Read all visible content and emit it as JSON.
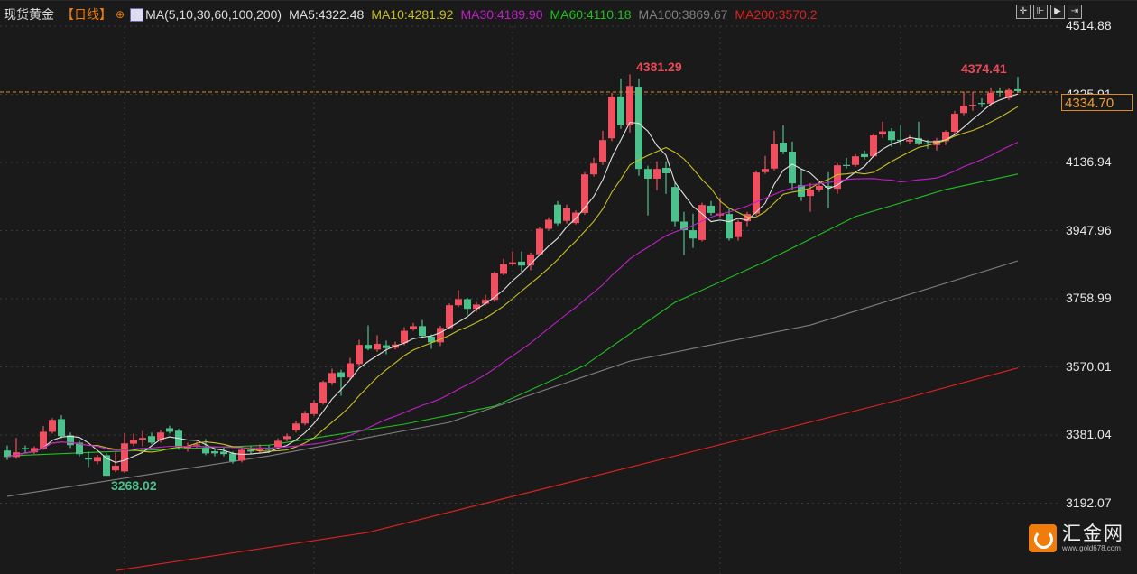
{
  "header": {
    "instrument": "现货黄金",
    "period": "【日线】",
    "ma_params": "MA(5,10,30,60,100,200)",
    "ma5": "MA5:4322.48",
    "ma10": "MA10:4281.92",
    "ma30": "MA30:4189.90",
    "ma60": "MA60:4110.18",
    "ma100": "MA100:3869.67",
    "ma200": "MA200:3570.2"
  },
  "toolbar": {
    "icons": [
      "crosshair-icon",
      "zoom-range-icon",
      "play-icon",
      "jump-end-icon"
    ]
  },
  "colors": {
    "up": "#f04f5f",
    "down": "#4dc18c",
    "ma5": "#e0e0e0",
    "ma10": "#c8c020",
    "ma30": "#c020c8",
    "ma60": "#20c020",
    "ma100": "#808080",
    "ma200": "#e02020",
    "current": "#e08a1e"
  },
  "chart_data": {
    "type": "candlestick",
    "y_axis_ticks": [
      "4514.88",
      "4325.91",
      "4136.94",
      "3947.96",
      "3758.99",
      "3570.01",
      "3381.04",
      "3192.07"
    ],
    "ylim": [
      3005,
      4560
    ],
    "grid": true,
    "current_price": "4334.70",
    "annotations": {
      "high1": "4381.29",
      "high2": "4374.41",
      "low1": "3268.02"
    },
    "ohlc": [
      [
        3338,
        3352,
        3312,
        3320
      ],
      [
        3320,
        3373,
        3315,
        3333
      ],
      [
        3345,
        3352,
        3330,
        3341
      ],
      [
        3333,
        3350,
        3328,
        3345
      ],
      [
        3343,
        3406,
        3340,
        3390
      ],
      [
        3390,
        3428,
        3385,
        3423
      ],
      [
        3425,
        3436,
        3372,
        3378
      ],
      [
        3380,
        3388,
        3345,
        3353
      ],
      [
        3360,
        3365,
        3322,
        3328
      ],
      [
        3318,
        3335,
        3292,
        3313
      ],
      [
        3308,
        3326,
        3300,
        3320
      ],
      [
        3325,
        3330,
        3268.02,
        3268
      ],
      [
        3283,
        3333,
        3278,
        3296
      ],
      [
        3280,
        3386,
        3276,
        3358
      ],
      [
        3357,
        3385,
        3350,
        3368
      ],
      [
        3368,
        3392,
        3350,
        3373
      ],
      [
        3378,
        3388,
        3355,
        3360
      ],
      [
        3366,
        3395,
        3360,
        3388
      ],
      [
        3400,
        3407,
        3385,
        3390
      ],
      [
        3393,
        3398,
        3340,
        3348
      ],
      [
        3345,
        3360,
        3335,
        3350
      ],
      [
        3352,
        3362,
        3345,
        3355
      ],
      [
        3345,
        3370,
        3325,
        3330
      ],
      [
        3336,
        3345,
        3322,
        3330
      ],
      [
        3335,
        3348,
        3322,
        3328
      ],
      [
        3330,
        3335,
        3302,
        3308
      ],
      [
        3310,
        3345,
        3305,
        3340
      ],
      [
        3340,
        3350,
        3328,
        3335
      ],
      [
        3338,
        3355,
        3332,
        3343
      ],
      [
        3345,
        3352,
        3334,
        3340
      ],
      [
        3348,
        3372,
        3344,
        3365
      ],
      [
        3370,
        3385,
        3364,
        3378
      ],
      [
        3394,
        3420,
        3388,
        3413
      ],
      [
        3413,
        3448,
        3408,
        3441
      ],
      [
        3439,
        3478,
        3434,
        3470
      ],
      [
        3470,
        3532,
        3465,
        3528
      ],
      [
        3526,
        3565,
        3520,
        3553
      ],
      [
        3555,
        3562,
        3490,
        3541
      ],
      [
        3541,
        3595,
        3535,
        3580
      ],
      [
        3578,
        3645,
        3572,
        3631
      ],
      [
        3631,
        3685,
        3616,
        3620
      ],
      [
        3618,
        3658,
        3612,
        3634
      ],
      [
        3630,
        3643,
        3605,
        3622
      ],
      [
        3623,
        3640,
        3618,
        3632
      ],
      [
        3636,
        3680,
        3630,
        3670
      ],
      [
        3675,
        3692,
        3670,
        3683
      ],
      [
        3683,
        3700,
        3650,
        3656
      ],
      [
        3654,
        3660,
        3620,
        3638
      ],
      [
        3638,
        3684,
        3628,
        3678
      ],
      [
        3678,
        3746,
        3674,
        3741
      ],
      [
        3741,
        3783,
        3736,
        3758
      ],
      [
        3758,
        3762,
        3715,
        3731
      ],
      [
        3731,
        3750,
        3722,
        3743
      ],
      [
        3745,
        3770,
        3740,
        3756
      ],
      [
        3756,
        3835,
        3750,
        3830
      ],
      [
        3828,
        3870,
        3824,
        3855
      ],
      [
        3855,
        3890,
        3850,
        3860
      ],
      [
        3862,
        3890,
        3830,
        3851
      ],
      [
        3852,
        3887,
        3838,
        3882
      ],
      [
        3882,
        3958,
        3878,
        3953
      ],
      [
        3953,
        3985,
        3948,
        3978
      ],
      [
        4020,
        4030,
        3962,
        3968
      ],
      [
        3975,
        4020,
        3968,
        4010
      ],
      [
        3969,
        4004,
        3965,
        3998
      ],
      [
        3997,
        4110,
        3992,
        4104
      ],
      [
        4104,
        4150,
        4098,
        4134
      ],
      [
        4139,
        4225,
        4130,
        4199
      ],
      [
        4204,
        4330,
        4196,
        4319
      ],
      [
        4320,
        4370,
        4230,
        4240
      ],
      [
        4240,
        4381.29,
        4220,
        4349
      ],
      [
        4347,
        4370,
        4100,
        4119
      ],
      [
        4119,
        4128,
        3990,
        4092
      ],
      [
        4092,
        4140,
        4060,
        4119
      ],
      [
        4122,
        4140,
        4050,
        4107
      ],
      [
        4069,
        4085,
        3960,
        3973
      ],
      [
        3973,
        4000,
        3880,
        3949
      ],
      [
        3949,
        3995,
        3900,
        3926
      ],
      [
        3922,
        4025,
        3918,
        4019
      ],
      [
        4017,
        4030,
        3990,
        3997
      ],
      [
        3990,
        4040,
        3985,
        3995
      ],
      [
        3994,
        4010,
        3920,
        3926
      ],
      [
        3930,
        3978,
        3920,
        3972
      ],
      [
        3974,
        4000,
        3960,
        3994
      ],
      [
        3995,
        4115,
        3990,
        4109
      ],
      [
        4110,
        4155,
        4105,
        4119
      ],
      [
        4120,
        4225,
        4115,
        4187
      ],
      [
        4192,
        4240,
        4160,
        4167
      ],
      [
        4167,
        4195,
        4060,
        4079
      ],
      [
        4074,
        4120,
        4030,
        4042
      ],
      [
        4044,
        4080,
        4000,
        4062
      ],
      [
        4062,
        4085,
        4055,
        4072
      ],
      [
        4072,
        4110,
        4010,
        4067
      ],
      [
        4064,
        4135,
        4050,
        4129
      ],
      [
        4130,
        4150,
        4120,
        4128
      ],
      [
        4130,
        4160,
        4125,
        4154
      ],
      [
        4160,
        4170,
        4145,
        4152
      ],
      [
        4154,
        4218,
        4150,
        4212
      ],
      [
        4215,
        4250,
        4205,
        4223
      ],
      [
        4224,
        4232,
        4180,
        4199
      ],
      [
        4200,
        4240,
        4185,
        4197
      ],
      [
        4195,
        4212,
        4188,
        4200
      ],
      [
        4204,
        4250,
        4185,
        4190
      ],
      [
        4190,
        4200,
        4175,
        4188
      ],
      [
        4185,
        4205,
        4170,
        4198
      ],
      [
        4196,
        4226,
        4185,
        4222
      ],
      [
        4222,
        4280,
        4215,
        4272
      ],
      [
        4274,
        4333,
        4268,
        4294
      ],
      [
        4295,
        4333,
        4280,
        4297
      ],
      [
        4302,
        4315,
        4290,
        4300
      ],
      [
        4300,
        4345,
        4295,
        4330
      ],
      [
        4335,
        4345,
        4320,
        4330
      ],
      [
        4315,
        4342,
        4310,
        4338
      ],
      [
        4340,
        4374.41,
        4330,
        4334.7
      ]
    ],
    "ma_long": {
      "ma60": {
        "i": [
          0,
          29,
          44,
          54,
          64,
          74,
          84,
          94,
          104,
          112
        ],
        "v": [
          3323,
          3353,
          3411,
          3461,
          3574,
          3749,
          3862,
          3987,
          4062,
          4105
        ]
      },
      "ma100": {
        "i": [
          0,
          29,
          49,
          69,
          89,
          112
        ],
        "v": [
          3211,
          3323,
          3416,
          3586,
          3686,
          3864
        ]
      },
      "ma200": {
        "i": [
          12,
          40,
          70,
          100,
          112
        ],
        "v": [
          3005,
          3111,
          3298,
          3486,
          3567
        ]
      }
    }
  },
  "logo": {
    "name": "汇金网",
    "url": "www.gold678.com"
  }
}
